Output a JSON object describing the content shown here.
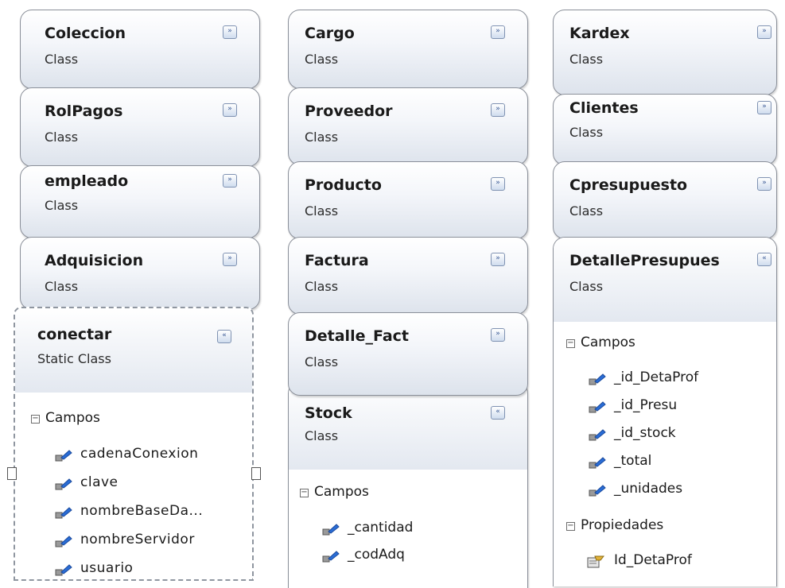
{
  "classes": [
    {
      "name": "Coleccion",
      "stereotype": "Class"
    },
    {
      "name": "RolPagos",
      "stereotype": "Class"
    },
    {
      "name": "empleado",
      "stereotype": "Class"
    },
    {
      "name": "Adquisicion",
      "stereotype": "Class"
    },
    {
      "name": "conectar",
      "stereotype": "Static Class",
      "section": "Campos",
      "fields": [
        "cadenaConexion",
        "clave",
        "nombreBaseDa...",
        "nombreServidor",
        "usuario"
      ]
    },
    {
      "name": "Cargo",
      "stereotype": "Class"
    },
    {
      "name": "Proveedor",
      "stereotype": "Class"
    },
    {
      "name": "Producto",
      "stereotype": "Class"
    },
    {
      "name": "Factura",
      "stereotype": "Class"
    },
    {
      "name": "Detalle_Fact",
      "stereotype": "Class"
    },
    {
      "name": "Stock",
      "stereotype": "Class",
      "section": "Campos",
      "fields": [
        "_cantidad",
        "_codAdq"
      ]
    },
    {
      "name": "Kardex",
      "stereotype": "Class"
    },
    {
      "name": "Clientes",
      "stereotype": "Class"
    },
    {
      "name": "Cpresupuesto",
      "stereotype": "Class"
    },
    {
      "name": "DetallePresupues",
      "stereotype": "Class",
      "section": "Campos",
      "fields": [
        "_id_DetaProf",
        "_id_Presu",
        "_id_stock",
        "_total",
        "_unidades"
      ],
      "section2": "Propiedades",
      "properties": [
        "Id_DetaProf"
      ]
    }
  ],
  "toggle_glyphs": {
    "collapsed": "»",
    "expanded": "«"
  },
  "section_glyph": "−"
}
